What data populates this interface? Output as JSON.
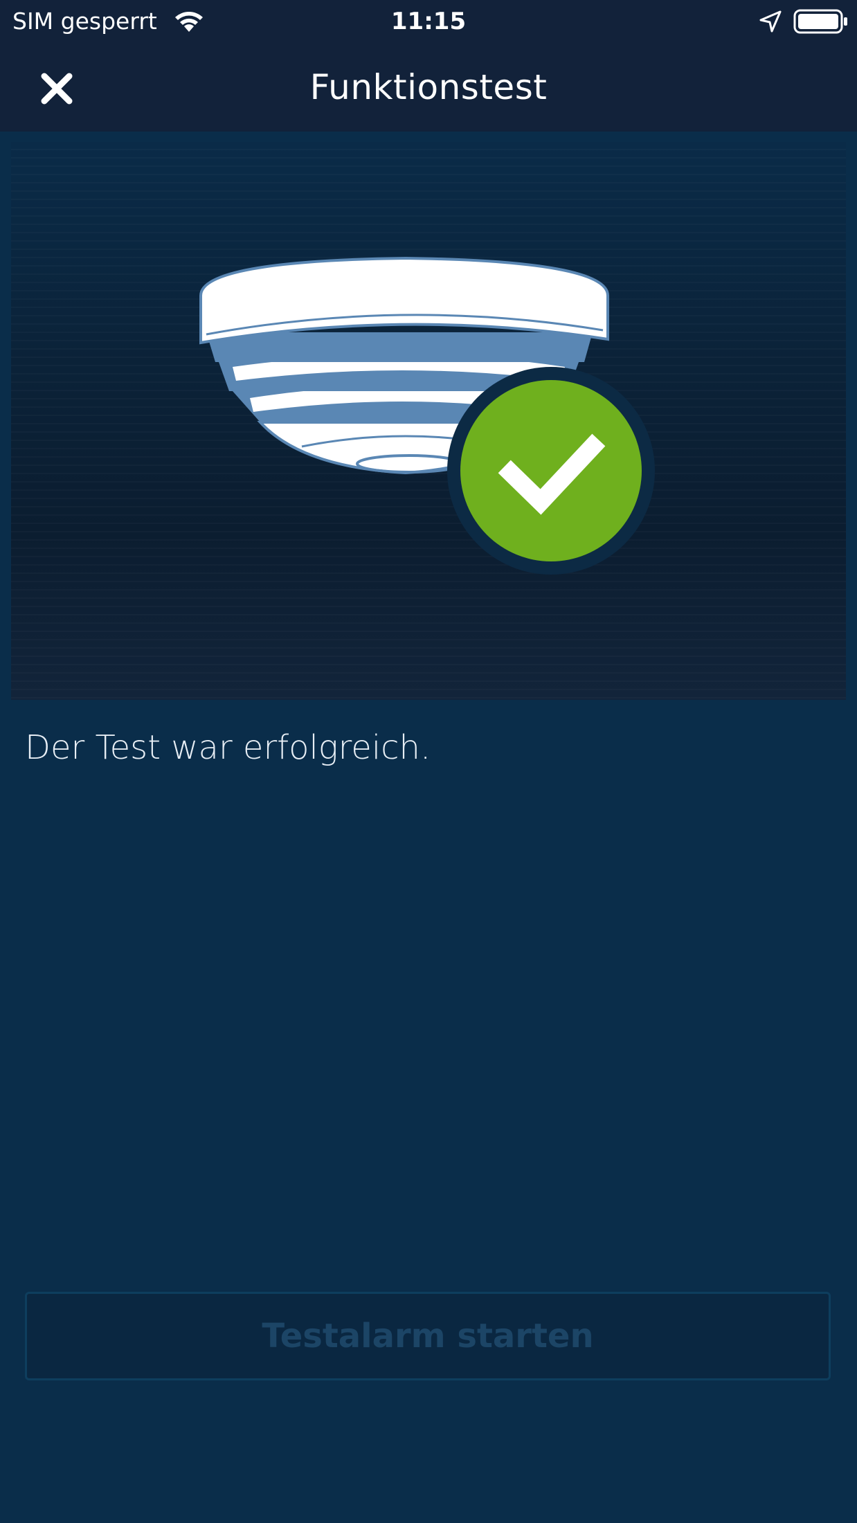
{
  "status_bar": {
    "carrier": "SIM gesperrt",
    "time": "11:15",
    "icons": [
      "wifi-icon",
      "location-arrow-icon",
      "battery-icon"
    ]
  },
  "nav": {
    "title": "Funktionstest",
    "close_icon": "close-icon"
  },
  "illustration": {
    "subject": "smoke-detector-icon",
    "status_icon": "checkmark-icon",
    "colors": {
      "detector_body": "#ffffff",
      "detector_stripes": "#5a87b4",
      "check_circle": "#6fb01e",
      "check_ring": "#0c2a44"
    }
  },
  "content": {
    "result_message": "Der Test war erfolgreich."
  },
  "actions": {
    "start_test_label": "Testalarm starten",
    "start_test_enabled": false
  },
  "colors": {
    "background": "#0a2d4a",
    "bar_background": "#12223a",
    "button_text_disabled": "#1c4566",
    "button_border_disabled": "#0e3e5e"
  }
}
